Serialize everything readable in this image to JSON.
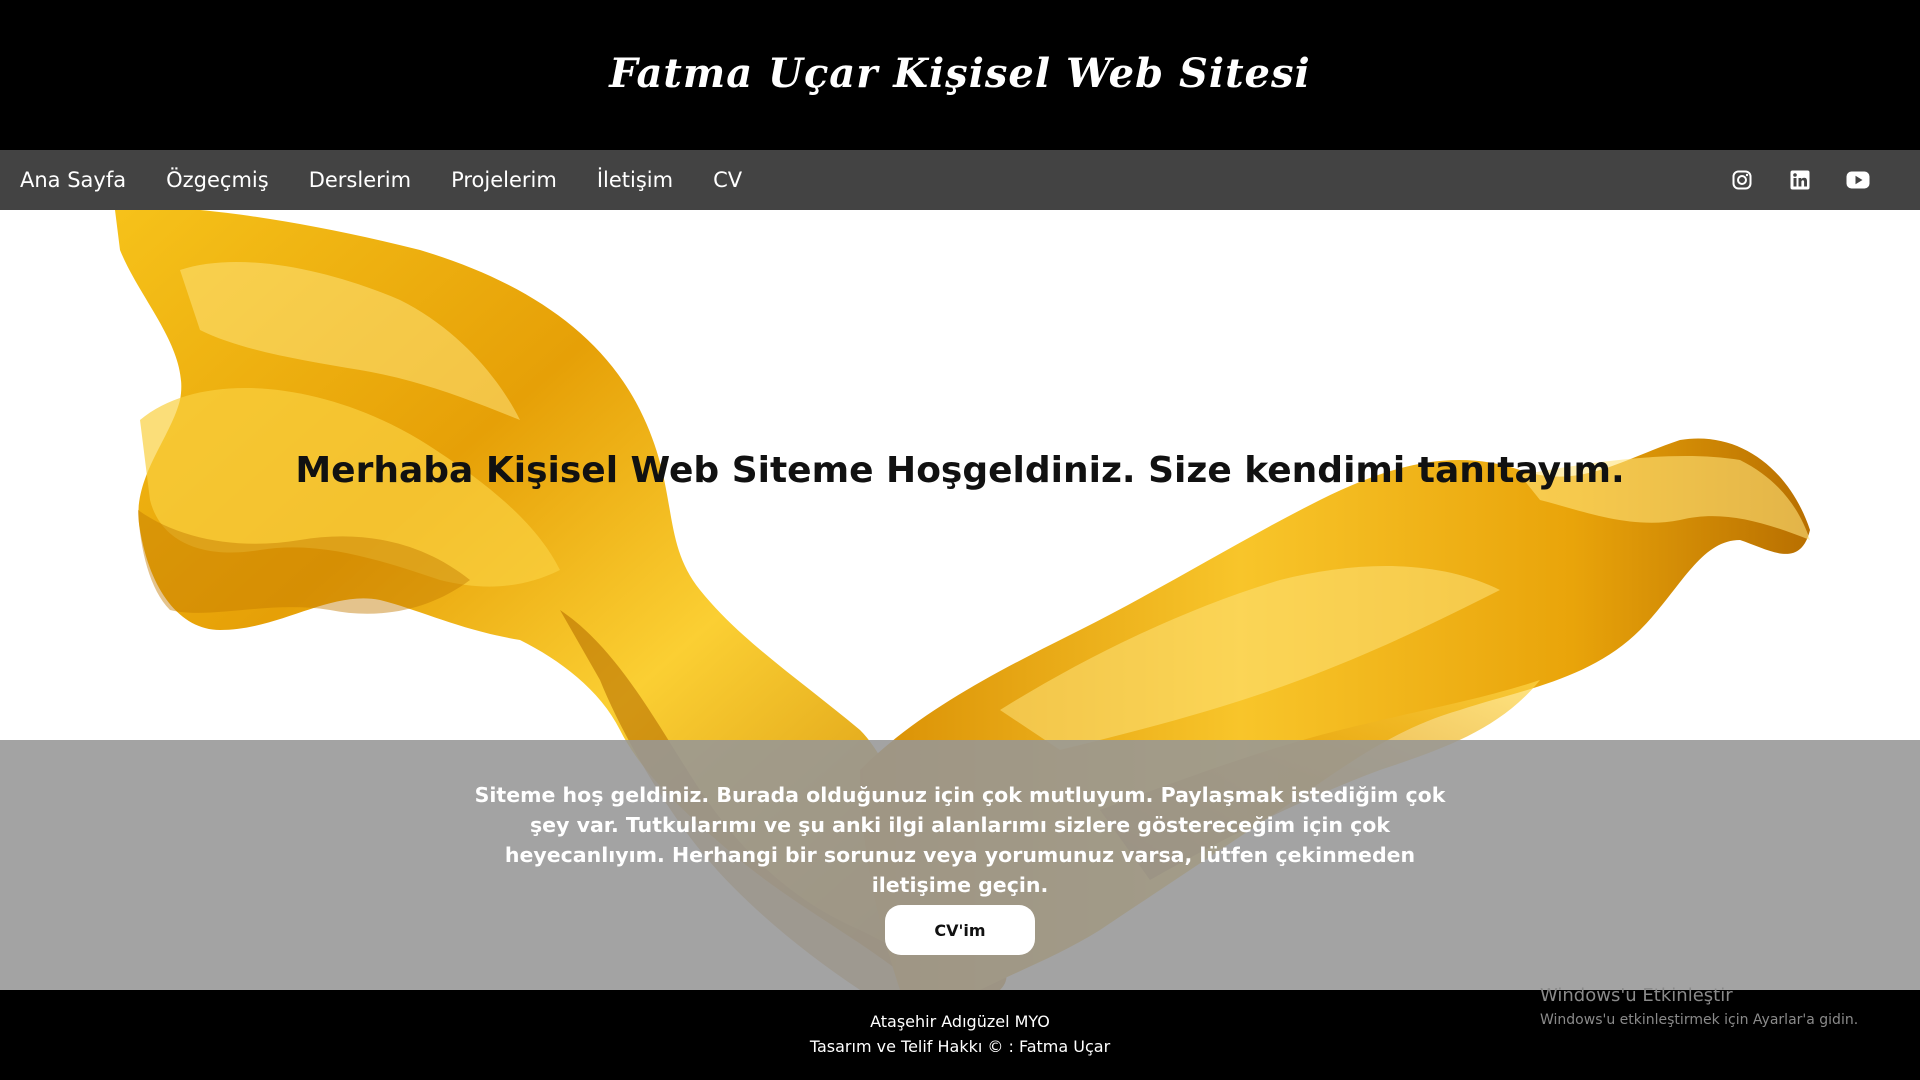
{
  "header": {
    "site_title": "Fatma Uçar Kişisel Web Sitesi"
  },
  "nav": {
    "items": [
      {
        "label": "Ana Sayfa"
      },
      {
        "label": "Özgeçmiş"
      },
      {
        "label": "Derslerim"
      },
      {
        "label": "Projelerim"
      },
      {
        "label": "İletişim"
      },
      {
        "label": "CV"
      }
    ],
    "social": [
      "instagram-icon",
      "linkedin-icon",
      "youtube-icon"
    ]
  },
  "hero": {
    "heading": "Merhaba Kişisel Web Siteme Hoşgeldiniz. Size kendimi tanıtayım.",
    "description": "Siteme hoş geldiniz. Burada olduğunuz için çok mutluyum. Paylaşmak istediğim çok şey var. Tutkularımı ve şu anki ilgi alanlarımı sizlere göstereceğim için çok heyecanlıyım. Herhangi bir sorunuz veya yorumunuz varsa, lütfen çekinmeden iletişime geçin.",
    "button_label": "CV'im"
  },
  "footer": {
    "line1": "Ataşehir Adıgüzel MYO",
    "line2": "Tasarım ve Telif Hakkı © : Fatma Uçar"
  },
  "os_watermark": {
    "title": "Windows'u Etkinleştir",
    "subtitle": "Windows'u etkinleştirmek için Ayarlar'a gidin."
  },
  "colors": {
    "header_bg": "#000000",
    "nav_bg": "#434343",
    "silk_gold": "#e8a90c",
    "panel_gray": "#969696"
  }
}
